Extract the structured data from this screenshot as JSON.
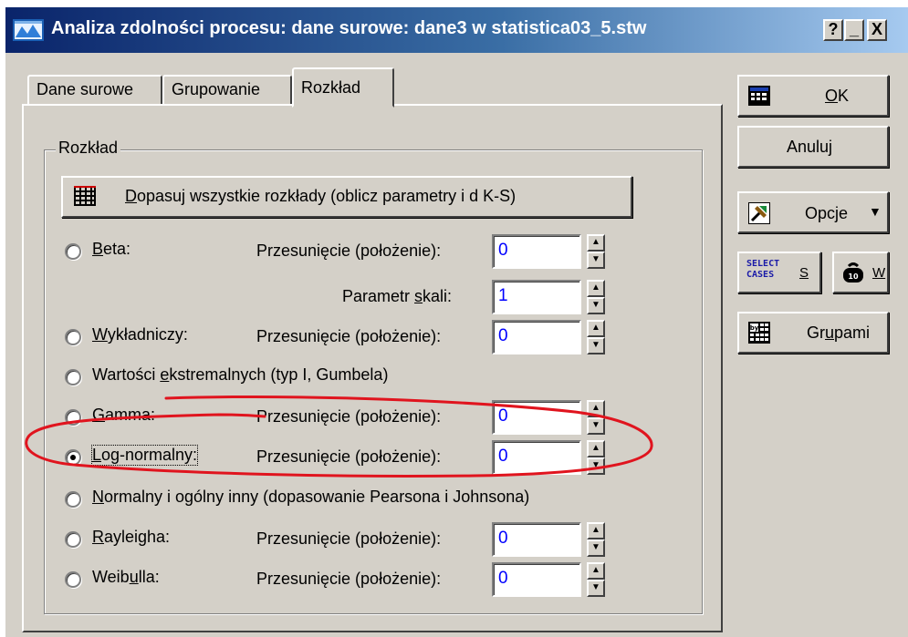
{
  "window": {
    "title": "Analiza zdolności procesu: dane surowe: dane3 w statistica03_5.stw",
    "help_label": "?",
    "min_label": "_",
    "close_label": "X"
  },
  "tabs": [
    {
      "label": "Dane surowe"
    },
    {
      "label": "Grupowanie"
    },
    {
      "label": "Rozkład"
    }
  ],
  "group": {
    "label": "Rozkład",
    "fit_all_prefix": "D",
    "fit_all_rest": "opasuj wszystkie rozkłady (oblicz parametry i d K-S)"
  },
  "distributions": [
    {
      "u": "B",
      "rest": "eta:",
      "checked": false,
      "fields": [
        {
          "label": "Przesunięcie (położenie):",
          "value": "0"
        },
        {
          "label_pre": "Parametr ",
          "label_u": "s",
          "label_post": "kali:",
          "value": "1"
        }
      ]
    },
    {
      "u": "W",
      "rest": "ykładniczy:",
      "checked": false,
      "fields": [
        {
          "label": "Przesunięcie (położenie):",
          "value": "0"
        }
      ]
    },
    {
      "pre": "Wartości ",
      "u": "e",
      "rest": "kstremalnych (typ I, Gumbela)",
      "checked": false,
      "fields": []
    },
    {
      "u": "G",
      "rest": "amma:",
      "checked": false,
      "fields": [
        {
          "label": "Przesunięcie (położenie):",
          "value": "0"
        }
      ]
    },
    {
      "u": "L",
      "rest": "og-normalny:",
      "checked": true,
      "fields": [
        {
          "label": "Przesunięcie (położenie):",
          "value": "0"
        }
      ]
    },
    {
      "u": "N",
      "rest": "ormalny i ogólny inny (dopasowanie Pearsona i Johnsona)",
      "checked": false,
      "fields": []
    },
    {
      "u": "R",
      "rest": "ayleigha:",
      "checked": false,
      "fields": [
        {
          "label": "Przesunięcie (położenie):",
          "value": "0"
        }
      ]
    },
    {
      "pre": "Weib",
      "u": "u",
      "rest": "lla:",
      "checked": false,
      "fields": [
        {
          "label": "Przesunięcie (położenie):",
          "value": "0"
        }
      ]
    }
  ],
  "buttons": {
    "ok_u": "O",
    "ok_rest": "K",
    "cancel": "Anuluj",
    "options": "Opcje",
    "select_icon_line1": "SELECT",
    "select_icon_line2": "CASES",
    "select_key": "S",
    "weight_key": "W",
    "groups_pre": "Gr",
    "groups_u": "u",
    "groups_post": "pami"
  },
  "colors": {
    "title_start": "#0a246a",
    "title_end": "#a6caf0",
    "face": "#d4d0c8",
    "field_value": "#0000ff",
    "annotation": "#e0141e"
  }
}
